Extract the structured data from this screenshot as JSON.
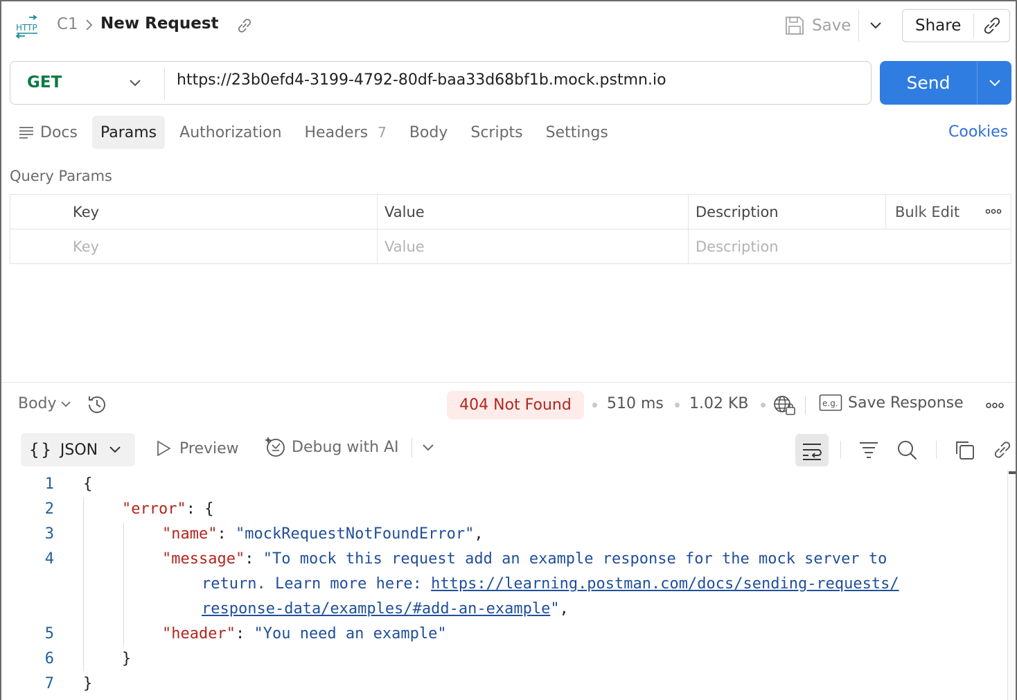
{
  "header": {
    "collection": "C1",
    "title": "New Request",
    "save_label": "Save",
    "share_label": "Share"
  },
  "request": {
    "method": "GET",
    "url": "https://23b0efd4-3199-4792-80df-baa33d68bf1b.mock.pstmn.io",
    "send_label": "Send"
  },
  "tabs": {
    "docs": "Docs",
    "params": "Params",
    "authorization": "Authorization",
    "headers": "Headers",
    "headers_count": "7",
    "body": "Body",
    "scripts": "Scripts",
    "settings": "Settings",
    "cookies": "Cookies"
  },
  "query_params": {
    "title": "Query Params",
    "columns": {
      "key": "Key",
      "value": "Value",
      "description": "Description",
      "bulk_edit": "Bulk Edit"
    },
    "placeholders": {
      "key": "Key",
      "value": "Value",
      "description": "Description"
    }
  },
  "response": {
    "body_tab": "Body",
    "status": "404 Not Found",
    "time": "510 ms",
    "size": "1.02 KB",
    "save_response": "Save Response",
    "format": "JSON",
    "format_braces": "{}",
    "preview": "Preview",
    "debug": "Debug with AI",
    "code": {
      "line_numbers": [
        "1",
        "2",
        "3",
        "4",
        "5",
        "6",
        "7"
      ],
      "open_brace": "{",
      "close_brace": "}",
      "inner_close": "}",
      "error_key": "\"error\"",
      "name_key": "\"name\"",
      "name_value": "\"mockRequestNotFoundError\"",
      "message_key": "\"message\"",
      "message_part1": "\"To mock this request add an example response for the mock server to",
      "message_part2": "return. Learn more here: ",
      "message_link1": "https://learning.postman.com/docs/sending-requests/",
      "message_link2": "response-data/examples/#add-an-example",
      "message_end": "\"",
      "header_key": "\"header\"",
      "header_value": "\"You need an example\""
    }
  },
  "colors": {
    "accent": "#2f7de1",
    "method_get": "#0b7a45",
    "status_error": "#b3261e",
    "status_error_bg": "#fdecea",
    "link": "#2f6fd6"
  }
}
